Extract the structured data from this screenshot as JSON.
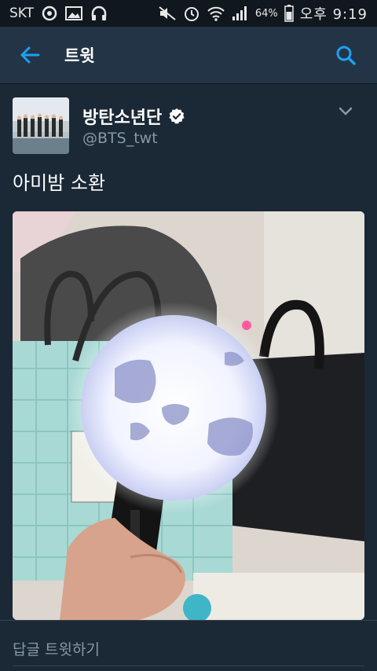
{
  "status_bar": {
    "carrier": "SKT",
    "battery": "64%",
    "time": "오후 9:19",
    "icons": [
      "chat-bubble-icon",
      "image-icon",
      "headphones-icon",
      "mute-icon",
      "alarm-icon",
      "wifi-icon",
      "signal-icon",
      "battery-icon"
    ]
  },
  "app_bar": {
    "title": "트윗",
    "back_icon": "arrow-left-icon",
    "search_icon": "search-icon"
  },
  "tweet": {
    "user_name": "방탄소년단",
    "verified": true,
    "handle": "@BTS_twt",
    "text": "아미밤 소환",
    "more_icon": "chevron-down-icon",
    "media": {
      "type": "photo",
      "subject": "lightstick-photo"
    }
  },
  "reply": {
    "placeholder": "답글 트윗하기"
  },
  "colors": {
    "background": "#1b2836",
    "app_bar": "#243447",
    "accent": "#1da1f2",
    "secondary_text": "#8899a6"
  }
}
